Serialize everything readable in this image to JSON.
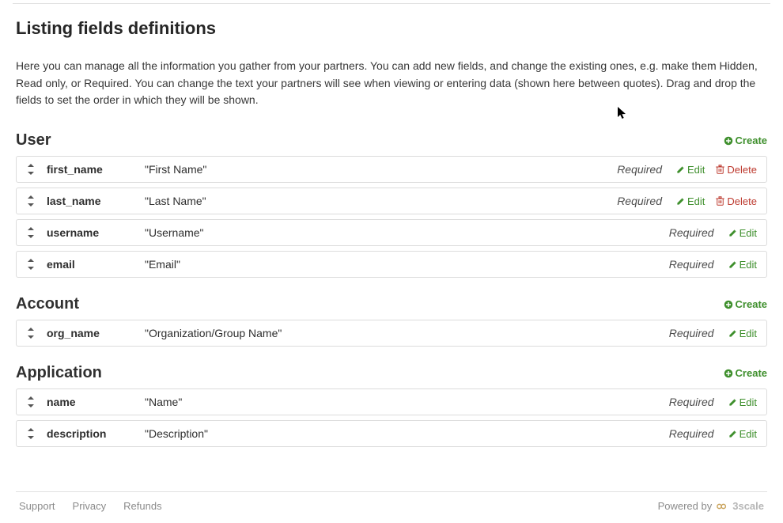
{
  "page": {
    "title": "Listing fields definitions",
    "intro": "Here you can manage all the information you gather from your partners. You can add new fields, and change the existing ones, e.g. make them Hidden, Read only, or Required. You can change the text your partners will see when viewing or entering data (shown here between quotes). Drag and drop the fields to set the order in which they will be shown."
  },
  "actions": {
    "create": "Create",
    "edit": "Edit",
    "delete": "Delete"
  },
  "sections": [
    {
      "title": "User",
      "fields": [
        {
          "name": "first_name",
          "label": "\"First Name\"",
          "status": "Required",
          "can_delete": true
        },
        {
          "name": "last_name",
          "label": "\"Last Name\"",
          "status": "Required",
          "can_delete": true
        },
        {
          "name": "username",
          "label": "\"Username\"",
          "status": "Required",
          "can_delete": false
        },
        {
          "name": "email",
          "label": "\"Email\"",
          "status": "Required",
          "can_delete": false
        }
      ]
    },
    {
      "title": "Account",
      "fields": [
        {
          "name": "org_name",
          "label": "\"Organization/Group Name\"",
          "status": "Required",
          "can_delete": false
        }
      ]
    },
    {
      "title": "Application",
      "fields": [
        {
          "name": "name",
          "label": "\"Name\"",
          "status": "Required",
          "can_delete": false
        },
        {
          "name": "description",
          "label": "\"Description\"",
          "status": "Required",
          "can_delete": false
        }
      ]
    }
  ],
  "footer": {
    "links": [
      "Support",
      "Privacy",
      "Refunds"
    ],
    "powered_by_prefix": "Powered by",
    "brand": "3scale"
  }
}
